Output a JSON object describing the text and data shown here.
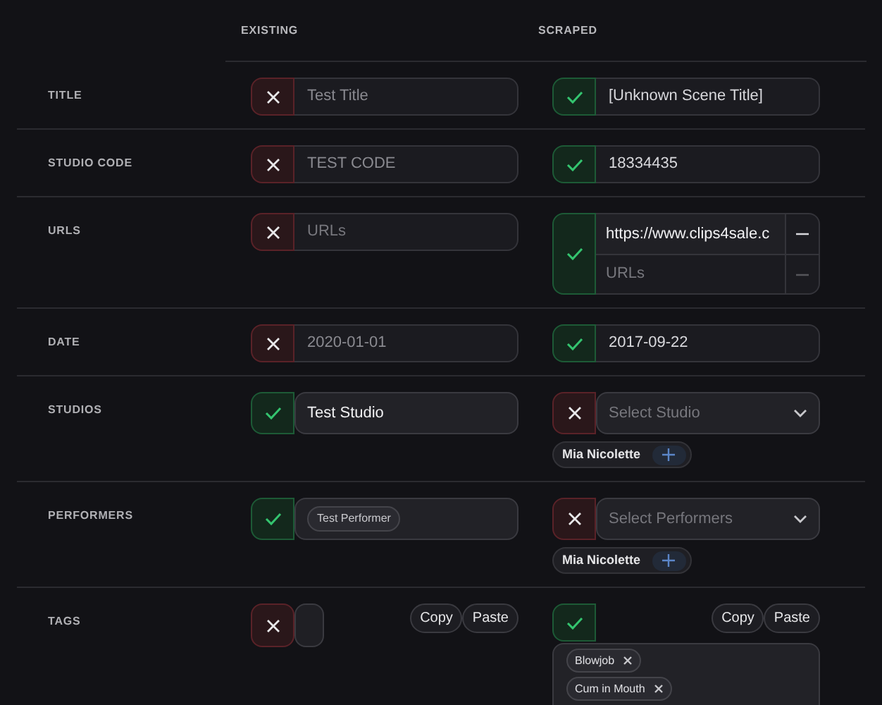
{
  "header": {
    "column_1": "EXISTING",
    "column_2": "SCRAPED"
  },
  "rows": [
    {
      "label": "TITLE",
      "existing": {
        "kind": "text",
        "selected": false,
        "value": "Test Title"
      },
      "scraped": {
        "kind": "text",
        "selected": true,
        "value": "[Unknown Scene Title]"
      }
    },
    {
      "label": "STUDIO CODE",
      "existing": {
        "kind": "text",
        "selected": false,
        "value": "TEST CODE"
      },
      "scraped": {
        "kind": "text",
        "selected": true,
        "value": "18334435"
      }
    },
    {
      "label": "URLS",
      "existing": {
        "kind": "text",
        "selected": false,
        "placeholder": "URLs"
      },
      "scraped": {
        "kind": "urls",
        "selected": true,
        "items": [
          {
            "value": "https://www.clips4sale.c"
          },
          {
            "placeholder": "URLs"
          }
        ]
      }
    },
    {
      "label": "DATE",
      "existing": {
        "kind": "text",
        "selected": false,
        "value": "2020-01-01"
      },
      "scraped": {
        "kind": "text",
        "selected": true,
        "value": "2017-09-22"
      }
    },
    {
      "label": "STUDIOS",
      "existing": {
        "kind": "select",
        "selected": true,
        "value": "Test Studio"
      },
      "scraped": {
        "kind": "select",
        "selected": false,
        "placeholder": "Select Studio",
        "new_items": [
          "Mia Nicolette"
        ]
      }
    },
    {
      "label": "PERFORMERS",
      "existing": {
        "kind": "multi",
        "selected": true,
        "chips": [
          "Test Performer"
        ]
      },
      "scraped": {
        "kind": "select",
        "selected": false,
        "placeholder": "Select Performers",
        "new_items": [
          "Mia Nicolette"
        ]
      }
    },
    {
      "label": "TAGS",
      "existing": {
        "kind": "tags",
        "selected": false,
        "buttons": [
          "Copy",
          "Paste"
        ]
      },
      "scraped": {
        "kind": "tags",
        "selected": true,
        "buttons": [
          "Copy",
          "Paste"
        ],
        "tags": [
          "Blowjob",
          "Cum in Mouth"
        ]
      }
    }
  ]
}
